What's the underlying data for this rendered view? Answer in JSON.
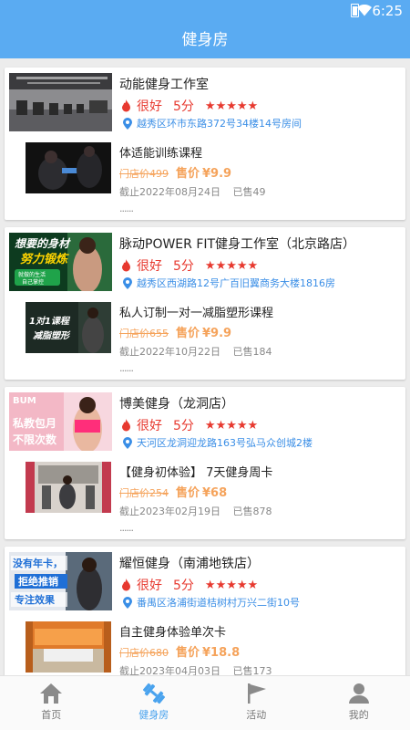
{
  "status_bar": {
    "time": "6:25"
  },
  "header": {
    "title": "健身房"
  },
  "stores": [
    {
      "name": "动能健身工作室",
      "rating_text": "很好",
      "score": "5分",
      "stars": "★★★★★",
      "address": "越秀区环市东路372号34楼14号房间",
      "course": {
        "name": "体适能训练课程",
        "original_price": "门店价499",
        "sale_label": "售价",
        "sale_price": "¥9.9",
        "deadline": "截止2022年08月24日",
        "sold": "已售49"
      },
      "more": "......"
    },
    {
      "name": "脉动POWER FIT健身工作室（北京路店）",
      "rating_text": "很好",
      "score": "5分",
      "stars": "★★★★★",
      "address": "越秀区西湖路12号广百旧翼商务大楼1816房",
      "banner_text": {
        "line1": "想要的身材",
        "line2": "努力锻炼",
        "tag": "就做的生活\n自己掌控"
      },
      "course": {
        "name": "私人订制一对一减脂塑形课程",
        "original_price": "门店价655",
        "sale_label": "售价",
        "sale_price": "¥9.9",
        "deadline": "截止2022年10月22日",
        "sold": "已售184",
        "thumb_text": {
          "line1": "1对1课程",
          "line2": "减脂塑形"
        }
      },
      "more": "......"
    },
    {
      "name": "博美健身（龙洞店）",
      "rating_text": "很好",
      "score": "5分",
      "stars": "★★★★★",
      "address": "天河区龙洞迎龙路163号弘马众创城2楼",
      "banner_text": {
        "top": "BUM",
        "line1": "私教包月",
        "line2": "不限次数"
      },
      "course": {
        "name": "【健身初体验】 7天健身周卡",
        "original_price": "门店价254",
        "sale_label": "售价",
        "sale_price": "¥68",
        "deadline": "截止2023年02月19日",
        "sold": "已售878"
      },
      "more": "......"
    },
    {
      "name": "耀恒健身（南浦地铁店）",
      "rating_text": "很好",
      "score": "5分",
      "stars": "★★★★★",
      "address": "番禺区洛浦街道桔树村万兴二街10号",
      "banner_text": {
        "line1": "没有年卡，",
        "line2": "拒绝推销",
        "line3": "专注效果"
      },
      "course": {
        "name": "自主健身体验单次卡",
        "original_price": "门店价680",
        "sale_label": "售价",
        "sale_price": "¥18.8",
        "deadline": "截止2023年04月03日",
        "sold": "已售173"
      },
      "more": "......"
    }
  ],
  "tabs": [
    {
      "label": "首页",
      "icon": "home-icon",
      "active": false
    },
    {
      "label": "健身房",
      "icon": "dumbbell-icon",
      "active": true
    },
    {
      "label": "活动",
      "icon": "flag-icon",
      "active": false
    },
    {
      "label": "我的",
      "icon": "user-icon",
      "active": false
    }
  ],
  "colors": {
    "primary": "#5aabf2",
    "rating_red": "#e7392f",
    "address_blue": "#3a8ee6",
    "price_orange": "#f5a35b",
    "tab_active": "#4aa3ee"
  }
}
